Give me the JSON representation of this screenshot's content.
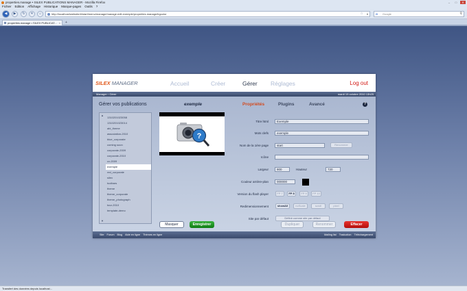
{
  "browser": {
    "window_title": "properties.manage • SILEX PUBLICATIONS MANAGER - Mozilla Firefox",
    "menu": [
      "Fichier",
      "Edition",
      "Affichage",
      "Historique",
      "Marque-pages",
      "Outils",
      "?"
    ],
    "url": "http://localhost/website/#/start/menu/manage/manage.edit.exemple/properties.manage/bgcolor",
    "search_placeholder": "Google",
    "tab_title": "properties.manage • SILEX PUBLICAT...",
    "status": "Transfert des données depuis localhost..."
  },
  "app": {
    "logo_brand": "SILEX",
    "logo_product": " MANAGER",
    "nav": [
      "Accueil",
      "Créer",
      "Gérer",
      "Réglages"
    ],
    "logout": "Log out",
    "breadcrumb": "Manager  ›  Gérer",
    "date": "mardi 19 octobre 2010 13h25",
    "section_title": "Gérer vos publications",
    "publication_name": "exemple",
    "tabs": [
      "Propriétés",
      "Plugins",
      "Avancé"
    ],
    "help": "?",
    "publications": [
      "1310201023058",
      "1310201023014",
      "abi_theme",
      "association-2010",
      "blue_corporate",
      "coming soon",
      "corporate-2009",
      "corporate-2010",
      "cv-2009",
      "exemple",
      "red_corporate",
      "silex",
      "toolbars",
      "theme",
      "theme_corporate",
      "theme_photograph",
      "tour-2010",
      "template-demo"
    ],
    "form": {
      "html_title_label": "Titre html",
      "html_title": "Exemple",
      "keywords_label": "Mots clefs",
      "keywords": "exemple",
      "first_page_label": "Nom de la 1ère page",
      "first_page": "start",
      "rename_btn": "Renommer",
      "icon_label": "Icône",
      "icon": "",
      "width_label": "Largeur",
      "width": "900",
      "height_label": "Hauteur",
      "height": "720",
      "bgcolor_label": "Couleur arrière-plan",
      "bgcolor": "000000",
      "bgcolor_swatch": "#000000",
      "flash_label": "Version du flash player",
      "flash_versions": [
        "FP 7",
        "FP 8",
        "FP 9",
        "FP 10"
      ],
      "resize_label": "Redimensionnement",
      "resize_modes": [
        "showAll",
        "noScale",
        "scroll",
        "pixel"
      ],
      "default_site_label": "Site par défaut",
      "default_site_btn": "Définir comme site par défaut"
    },
    "actions": {
      "hide": "Masquer",
      "save": "Enregistrer",
      "duplicate": "Dupliquer",
      "rename": "Renommer",
      "delete": "Effacer"
    },
    "footer_left": [
      "Site",
      "Forum",
      "Blog",
      "Aide en ligne",
      "Thèmes en ligne"
    ],
    "footer_right": [
      "Mailing list",
      "Traduction",
      "Téléchargement"
    ]
  }
}
